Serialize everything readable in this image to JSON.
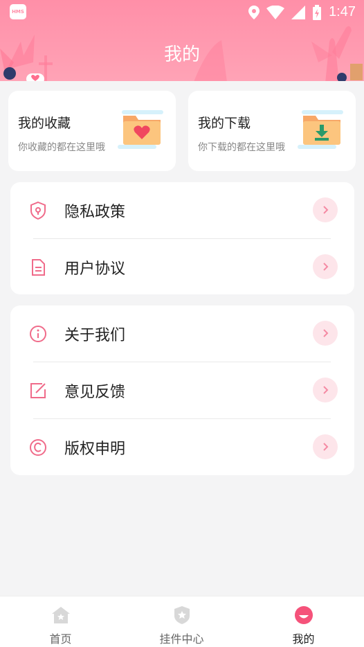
{
  "status_bar": {
    "badge": "HMS",
    "time": "1:47"
  },
  "header": {
    "title": "我的"
  },
  "quick_cards": [
    {
      "title": "我的收藏",
      "subtitle": "你收藏的都在这里哦",
      "icon": "heart-folder-icon"
    },
    {
      "title": "我的下载",
      "subtitle": "你下载的都在这里哦",
      "icon": "download-folder-icon"
    }
  ],
  "menu_group_1": [
    {
      "label": "隐私政策",
      "icon": "shield-icon"
    },
    {
      "label": "用户协议",
      "icon": "document-icon"
    }
  ],
  "menu_group_2": [
    {
      "label": "关于我们",
      "icon": "info-icon"
    },
    {
      "label": "意见反馈",
      "icon": "edit-icon"
    },
    {
      "label": "版权申明",
      "icon": "copyright-icon"
    }
  ],
  "tabs": [
    {
      "label": "首页",
      "icon": "home-icon"
    },
    {
      "label": "挂件中心",
      "icon": "badge-icon"
    },
    {
      "label": "我的",
      "icon": "profile-icon"
    }
  ],
  "colors": {
    "accent": "#ff8fa8",
    "icon_pink": "#f06b8a",
    "arrow_bg": "#fde5ea"
  }
}
